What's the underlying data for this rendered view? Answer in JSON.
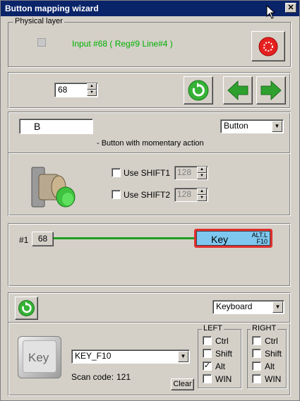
{
  "window": {
    "title": "Button mapping wizard",
    "close_glyph": "✕"
  },
  "physical": {
    "legend": "Physical layer",
    "input_text": "Input #68  ( Reg#9  Line#4 )",
    "input_color": "#00b000"
  },
  "nav": {
    "index_value": "68"
  },
  "mapping": {
    "name_value": "B",
    "type_value": "Button",
    "description": "- Button with momentary action",
    "shift1_label": "Use SHIFT1",
    "shift1_value": "128",
    "shift2_label": "Use SHIFT2",
    "shift2_value": "128"
  },
  "line": {
    "index_label": "#1",
    "index_value": "68",
    "target_label": "Key",
    "modifier_top": "ALT.L",
    "modifier_bottom": "F10"
  },
  "output": {
    "device_value": "Keyboard",
    "key_image_label": "Key",
    "key_value": "KEY_F10",
    "scan_label": "Scan code:",
    "scan_value": "121",
    "clear_label": "Clear",
    "left_legend": "LEFT",
    "right_legend": "RIGHT",
    "left": [
      {
        "label": "Ctrl",
        "checked": false
      },
      {
        "label": "Shift",
        "checked": false
      },
      {
        "label": "Alt",
        "checked": true
      },
      {
        "label": "WIN",
        "checked": false
      }
    ],
    "right": [
      {
        "label": "Ctrl",
        "checked": false
      },
      {
        "label": "Shift",
        "checked": false
      },
      {
        "label": "Alt",
        "checked": false
      },
      {
        "label": "WIN",
        "checked": false
      }
    ]
  },
  "colors": {
    "accent_green": "#2ea02e",
    "key_blue": "#7ec8f0",
    "key_border": "#e03030",
    "link_green": "#20a020"
  },
  "icons": [
    "refresh-icon",
    "arrow-left-icon",
    "arrow-right-icon",
    "stop-icon",
    "pushbutton-image",
    "key-image"
  ]
}
